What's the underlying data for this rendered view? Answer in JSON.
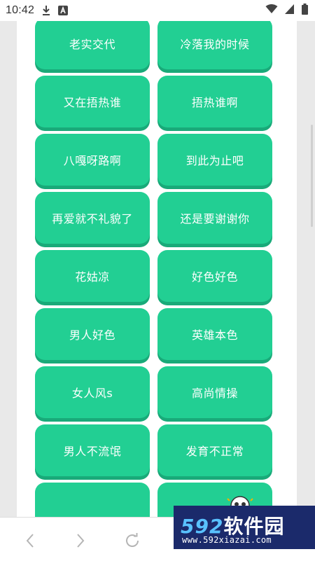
{
  "status_bar": {
    "time": "10:42",
    "icons": [
      "download-icon",
      "a-box-icon",
      "wifi-icon",
      "signal-icon",
      "battery-icon"
    ]
  },
  "buttons": [
    "老实交代",
    "冷落我的时候",
    "又在捂热谁",
    "捂热谁啊",
    "八嘎呀路啊",
    "到此为止吧",
    "再爱就不礼貌了",
    "还是要谢谢你",
    "花姑凉",
    "好色好色",
    "男人好色",
    "英雄本色",
    "女人风s",
    "高尚情操",
    "男人不流氓",
    "发育不正常",
    "",
    ""
  ],
  "nav": {
    "icons": [
      "back-icon",
      "forward-icon",
      "refresh-icon"
    ]
  },
  "watermark": {
    "brand_num": "592",
    "brand_text": "软件园",
    "url": "www.592xiazai.com"
  },
  "colors": {
    "button": "#22cf93",
    "button_shadow": "#19aa79",
    "page_bg": "#ffffff",
    "outer_bg": "#e9e9e9"
  }
}
